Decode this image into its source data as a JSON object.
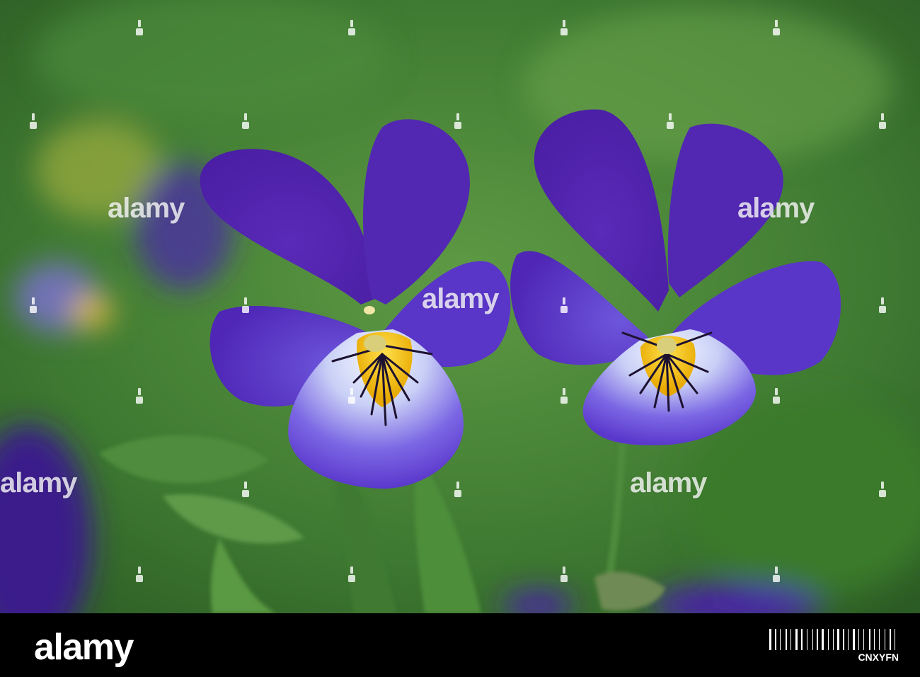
{
  "photo": {
    "subject": "two violet pansy flowers",
    "colors": {
      "background_green": "#4f8a3a",
      "dark_green": "#2e5a22",
      "petal_purple": "#5d2fc0",
      "petal_light": "#7f63e6",
      "lip_white": "#e8eefc",
      "center_yellow": "#f2c300",
      "vein_dark": "#1d1230"
    }
  },
  "watermark": {
    "text": "alamy"
  },
  "footer": {
    "logo": "alamy",
    "image_id": "CNXYFN",
    "barcode": [
      3,
      1,
      2,
      1,
      1,
      3,
      2,
      1,
      1,
      2,
      3,
      1,
      2,
      2,
      1,
      3,
      1,
      1,
      2,
      1,
      3,
      2,
      1,
      2,
      1,
      1,
      3,
      1,
      2,
      1,
      1,
      2,
      3,
      1,
      1,
      2,
      1,
      3,
      2,
      1,
      1,
      2,
      1,
      3,
      1,
      2,
      2,
      1,
      1,
      3
    ]
  }
}
